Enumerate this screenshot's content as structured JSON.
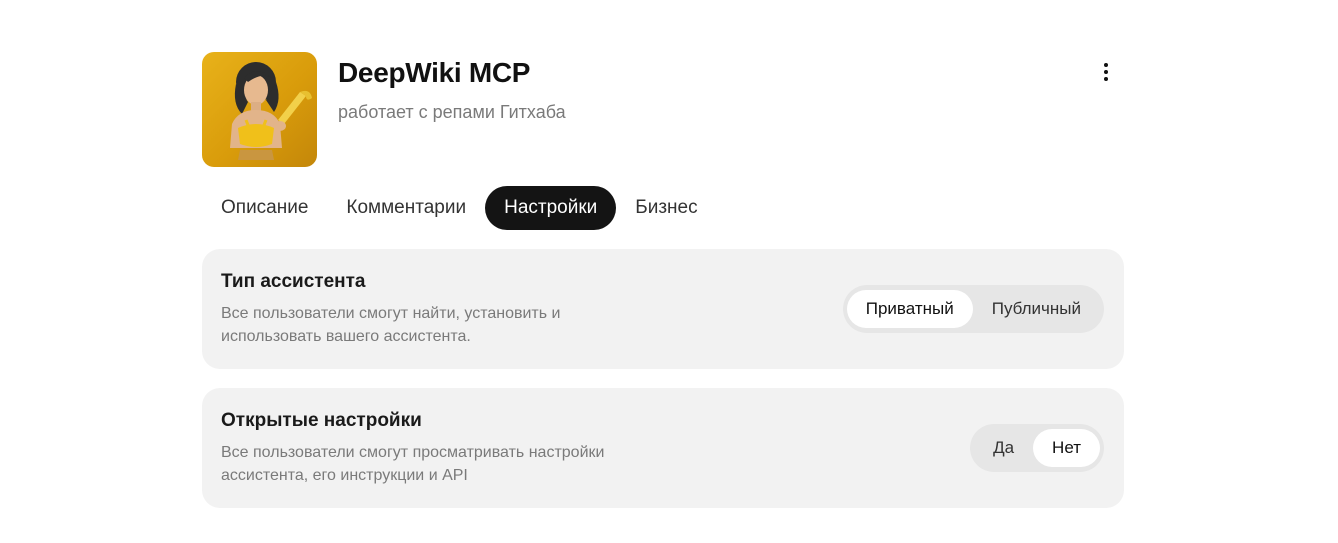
{
  "assistant": {
    "name": "DeepWiki MCP",
    "subtitle": "работает с репами Гитхаба"
  },
  "tabs": [
    {
      "label": "Описание",
      "active": false
    },
    {
      "label": "Комментарии",
      "active": false
    },
    {
      "label": "Настройки",
      "active": true
    },
    {
      "label": "Бизнес",
      "active": false
    }
  ],
  "settings": {
    "assistant_type": {
      "title": "Тип ассистента",
      "description": "Все пользователи смогут найти, установить и использовать вашего ассистента.",
      "options": [
        "Приватный",
        "Публичный"
      ],
      "selected": "Приватный"
    },
    "open_settings": {
      "title": "Открытые настройки",
      "description": "Все пользователи смогут просматривать настройки ассистента, его инструкции и API",
      "options": [
        "Да",
        "Нет"
      ],
      "selected": "Нет"
    }
  },
  "colors": {
    "active_tab_bg": "#141414",
    "card_bg": "#f2f2f2",
    "avatar_bg": "#e0a812"
  }
}
